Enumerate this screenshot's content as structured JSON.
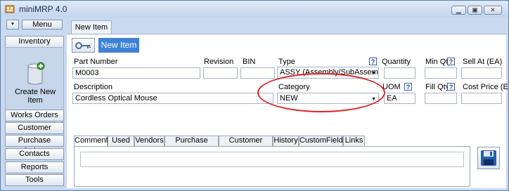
{
  "window": {
    "title": "miniMRP 4.0",
    "min_label": "▁",
    "max_label": "▣",
    "close_label": "✕"
  },
  "sidebar": {
    "menu_label": "Menu",
    "inventory_label": "Inventory",
    "create_item_label": "Create New Item",
    "nav": [
      "Works Orders",
      "Customer Orders",
      "Purchase Orders",
      "Contacts",
      "Reports",
      "Tools"
    ]
  },
  "doc_tab": "New Item",
  "toolbar": {
    "new_item_label": "New Item"
  },
  "form": {
    "part_number": {
      "label": "Part Number",
      "value": "M0003"
    },
    "revision": {
      "label": "Revision",
      "value": ""
    },
    "bin": {
      "label": "BIN",
      "value": ""
    },
    "type": {
      "label": "Type",
      "value": "ASSY (Assembly/SubAssembly)"
    },
    "quantity": {
      "label": "Quantity",
      "value": ""
    },
    "min_qty": {
      "label": "Min Qty",
      "value": ""
    },
    "sell_at": {
      "label": "Sell At (EA)",
      "value": ""
    },
    "description": {
      "label": "Description",
      "value": "Cordless Optical Mouse"
    },
    "category": {
      "label": "Category",
      "value": "NEW"
    },
    "uom": {
      "label": "UOM",
      "value": "EA"
    },
    "fill_qty": {
      "label": "Fill Qty",
      "value": ""
    },
    "cost_price": {
      "label": "Cost Price (EA)",
      "value": ""
    },
    "help_glyph": "?"
  },
  "subtabs": [
    "Comments",
    "Used In",
    "Vendors",
    "Purchase Orders",
    "Customer Orders",
    "History",
    "CustomFields",
    "Links"
  ],
  "active_subtab": "Comments",
  "comments_value": "",
  "colors": {
    "highlight_ellipse": "#e02020",
    "new_item_button": "#3e82d6"
  }
}
